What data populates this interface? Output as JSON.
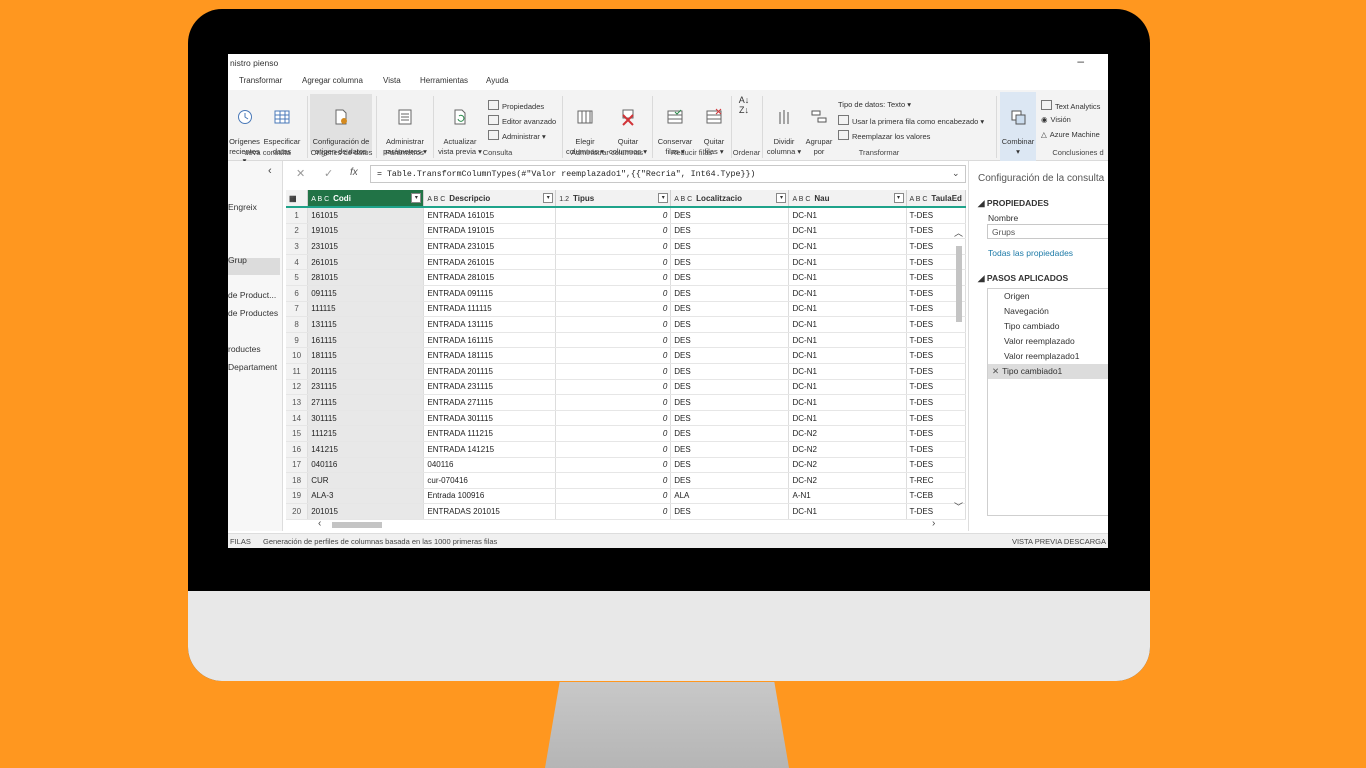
{
  "window": {
    "title": "nistro pienso",
    "minimize": "–"
  },
  "menu": [
    "Transformar",
    "Agregar columna",
    "Vista",
    "Herramientas",
    "Ayuda"
  ],
  "ribbon": {
    "recientes": "Orígenes\nrecientes ▾",
    "especificar": "Especificar\ndatos",
    "config_origen": "Configuración de\norigen de datos",
    "admin_param": "Administrar\nparámetros ▾",
    "actualizar": "Actualizar\nvista previa ▾",
    "propiedades": "Propiedades",
    "editor": "Editor avanzado",
    "administrar": "Administrar ▾",
    "elegir": "Elegir\ncolumnas ▾",
    "quitar": "Quitar\ncolumnas ▾",
    "conservar": "Conservar\nfilas ▾",
    "quitar_filas": "Quitar\nfilas ▾",
    "dividir": "Dividir\ncolumna ▾",
    "agrupar": "Agrupar\npor",
    "tipo_datos": "Tipo de datos: Texto ▾",
    "primera_fila": "Usar la primera fila como encabezado ▾",
    "reemplazar": "Reemplazar los valores",
    "combinar": "Combinar\n▾",
    "text_analytics": "Text Analytics",
    "vision": "Visión",
    "azure": "Azure Machine",
    "groups": {
      "nueva": "ueva consulta",
      "origenes": "Orígenes de datos",
      "parametros": "Parámetros",
      "consulta": "Consulta",
      "admin_col": "Administrar columnas",
      "reducir": "Reducir filas",
      "ordenar": "Ordenar",
      "transformar": "Transformar",
      "conclusiones": "Conclusiones d"
    }
  },
  "queries": [
    "Engreix",
    "Grup",
    "de Product...",
    "de Productes",
    "roductes",
    "Departament"
  ],
  "formula": "= Table.TransformColumnTypes(#\"Valor reemplazado1\",{{\"Recria\", Int64.Type}})",
  "formula_icons": {
    "cancel": "✕",
    "commit": "✓",
    "fx": "fx"
  },
  "columns": [
    {
      "type": "A B C",
      "name": "Codi"
    },
    {
      "type": "A B C",
      "name": "Descripcio"
    },
    {
      "type": "1.2",
      "name": "Tipus"
    },
    {
      "type": "A B C",
      "name": "Localitzacio"
    },
    {
      "type": "A B C",
      "name": "Nau"
    },
    {
      "type": "A B C",
      "name": "TaulaEd"
    }
  ],
  "rows": [
    [
      "1",
      "161015",
      "ENTRADA 161015",
      "0",
      "DES",
      "DC-N1",
      "T-DES"
    ],
    [
      "2",
      "191015",
      "ENTRADA 191015",
      "0",
      "DES",
      "DC-N1",
      "T-DES"
    ],
    [
      "3",
      "231015",
      "ENTRADA 231015",
      "0",
      "DES",
      "DC-N1",
      "T-DES"
    ],
    [
      "4",
      "261015",
      "ENTRADA 261015",
      "0",
      "DES",
      "DC-N1",
      "T-DES"
    ],
    [
      "5",
      "281015",
      "ENTRADA 281015",
      "0",
      "DES",
      "DC-N1",
      "T-DES"
    ],
    [
      "6",
      "091115",
      "ENTRADA 091115",
      "0",
      "DES",
      "DC-N1",
      "T-DES"
    ],
    [
      "7",
      "111115",
      "ENTRADA 111115",
      "0",
      "DES",
      "DC-N1",
      "T-DES"
    ],
    [
      "8",
      "131115",
      "ENTRADA 131115",
      "0",
      "DES",
      "DC-N1",
      "T-DES"
    ],
    [
      "9",
      "161115",
      "ENTRADA 161115",
      "0",
      "DES",
      "DC-N1",
      "T-DES"
    ],
    [
      "10",
      "181115",
      "ENTRADA 181115",
      "0",
      "DES",
      "DC-N1",
      "T-DES"
    ],
    [
      "11",
      "201115",
      "ENTRADA 201115",
      "0",
      "DES",
      "DC-N1",
      "T-DES"
    ],
    [
      "12",
      "231115",
      "ENTRADA 231115",
      "0",
      "DES",
      "DC-N1",
      "T-DES"
    ],
    [
      "13",
      "271115",
      "ENTRADA 271115",
      "0",
      "DES",
      "DC-N1",
      "T-DES"
    ],
    [
      "14",
      "301115",
      "ENTRADA 301115",
      "0",
      "DES",
      "DC-N1",
      "T-DES"
    ],
    [
      "15",
      "111215",
      "ENTRADA 111215",
      "0",
      "DES",
      "DC-N2",
      "T-DES"
    ],
    [
      "16",
      "141215",
      "ENTRADA 141215",
      "0",
      "DES",
      "DC-N2",
      "T-DES"
    ],
    [
      "17",
      "040116",
      "040116",
      "0",
      "DES",
      "DC-N2",
      "T-DES"
    ],
    [
      "18",
      "CUR",
      "cur-070416",
      "0",
      "DES",
      "DC-N2",
      "T-REC"
    ],
    [
      "19",
      "ALA-3",
      "Entrada 100916",
      "0",
      "ALA",
      "A-N1",
      "T-CEB"
    ],
    [
      "20",
      "201015",
      "ENTRADAS 201015",
      "0",
      "DES",
      "DC-N1",
      "T-DES"
    ]
  ],
  "status": {
    "left": "FILAS",
    "profile": "Generación de perfiles de columnas basada en las 1000 primeras filas",
    "right": "VISTA PREVIA DESCARGA"
  },
  "settings": {
    "title": "Configuración de la consulta",
    "props": "PROPIEDADES",
    "name_label": "Nombre",
    "name_value": "Grups",
    "all_props": "Todas las propiedades",
    "steps_title": "PASOS APLICADOS",
    "steps": [
      "Origen",
      "Navegación",
      "Tipo cambiado",
      "Valor reemplazado",
      "Valor reemplazado1"
    ],
    "active_step": "Tipo cambiado1",
    "remove_icon": "✕"
  },
  "colors": {
    "accent": "#217346",
    "teal": "#1FA38A",
    "background": "#FF971F"
  }
}
